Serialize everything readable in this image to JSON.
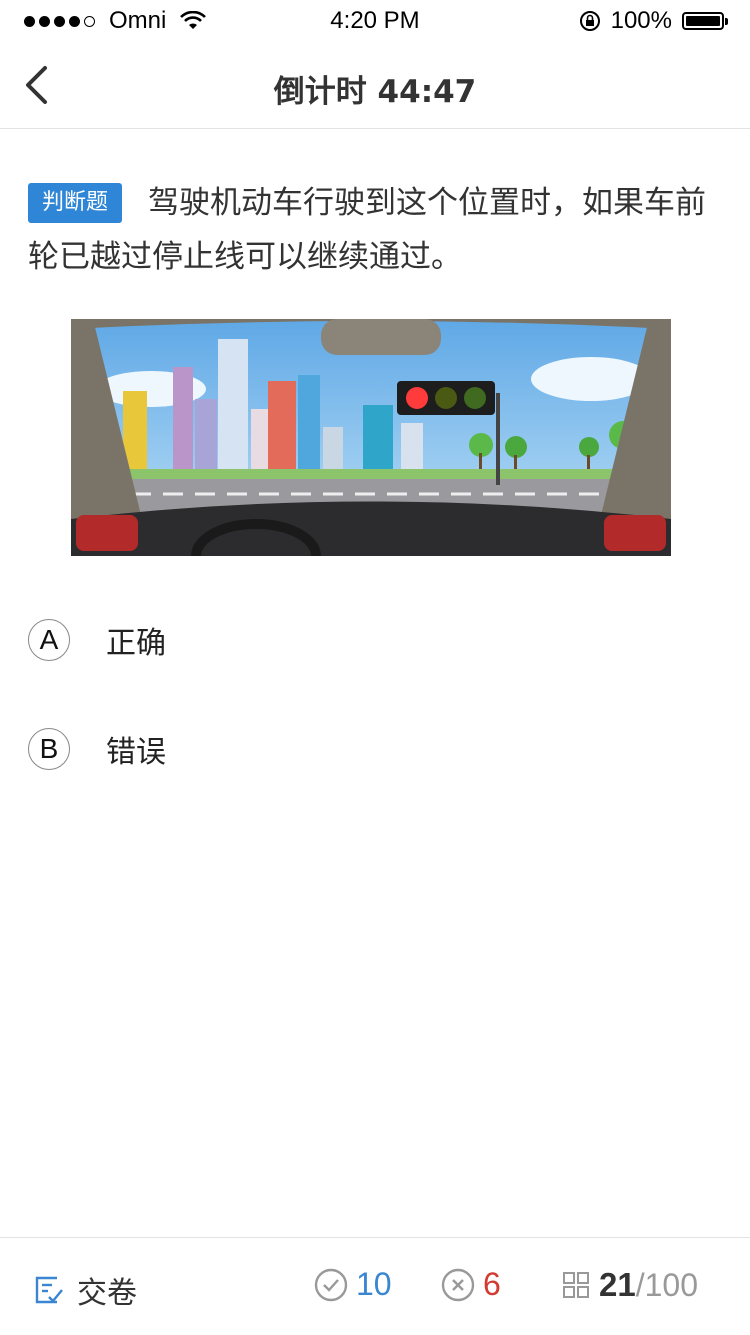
{
  "status_bar": {
    "carrier": "Omni",
    "time": "4:20 PM",
    "battery": "100%"
  },
  "nav": {
    "title": "倒计时 44:47"
  },
  "question": {
    "type_tag": "判断题",
    "text": "驾驶机动车行驶到这个位置时，如果车前轮已越过停止线可以继续通过。"
  },
  "options": [
    {
      "letter": "A",
      "text": "正确"
    },
    {
      "letter": "B",
      "text": "错误"
    }
  ],
  "bottom": {
    "submit_label": "交卷",
    "correct_count": "10",
    "wrong_count": "6",
    "current": "21",
    "separator": "/",
    "total": "100"
  },
  "colors": {
    "accent": "#2f86d6",
    "correct": "#3a86d0",
    "wrong": "#d23b2f"
  }
}
